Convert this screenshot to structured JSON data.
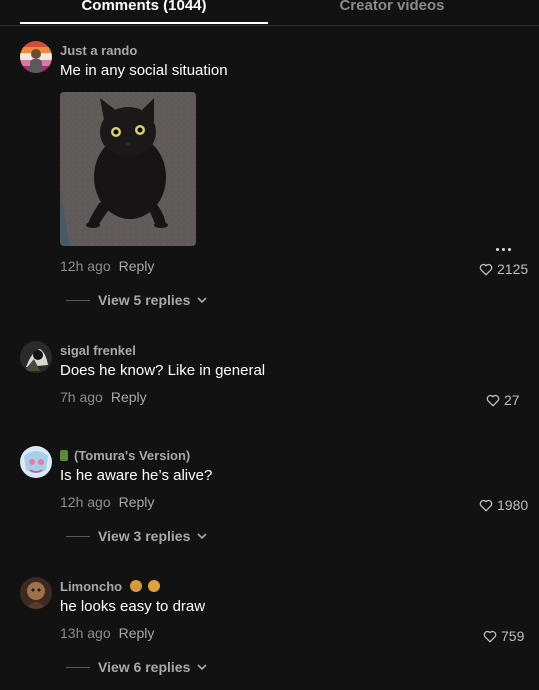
{
  "tabs": {
    "comments_label": "Comments (1044)",
    "creator_videos_label": "Creator videos"
  },
  "comments": [
    {
      "username": "Just a rando",
      "text": "Me in any social situation",
      "time": "12h ago",
      "reply_label": "Reply",
      "likes": "2125",
      "replies_label": "View 5 replies",
      "has_image": true,
      "avatar_colors": [
        "#e05a4a",
        "#f0b03a",
        "#c05aa0"
      ]
    },
    {
      "username": "sigal frenkel",
      "text": "Does he know? Like in general",
      "time": "7h ago",
      "reply_label": "Reply",
      "likes": "27",
      "avatar_colors": [
        "#3a3a3a",
        "#e8e8e8"
      ]
    },
    {
      "username": "(Tomura's Version)",
      "text": "Is he aware he’s alive?",
      "time": "12h ago",
      "reply_label": "Reply",
      "likes": "1980",
      "replies_label": "View 3 replies",
      "avatar_colors": [
        "#b8d8f0",
        "#f0c0d8"
      ]
    },
    {
      "username": "Limoncho",
      "text": "he looks easy to draw",
      "time": "13h ago",
      "reply_label": "Reply",
      "likes": "759",
      "replies_label": "View 6 replies",
      "avatar_colors": [
        "#5a3a2a",
        "#a07048"
      ]
    }
  ],
  "colors": {
    "background": "#121212",
    "secondary_text": "#8c8c8c",
    "heart": "#bdbdbd"
  },
  "icons": {
    "heart": "heart-outline-icon",
    "chevron": "chevron-down-icon",
    "more": "more-options-icon"
  }
}
